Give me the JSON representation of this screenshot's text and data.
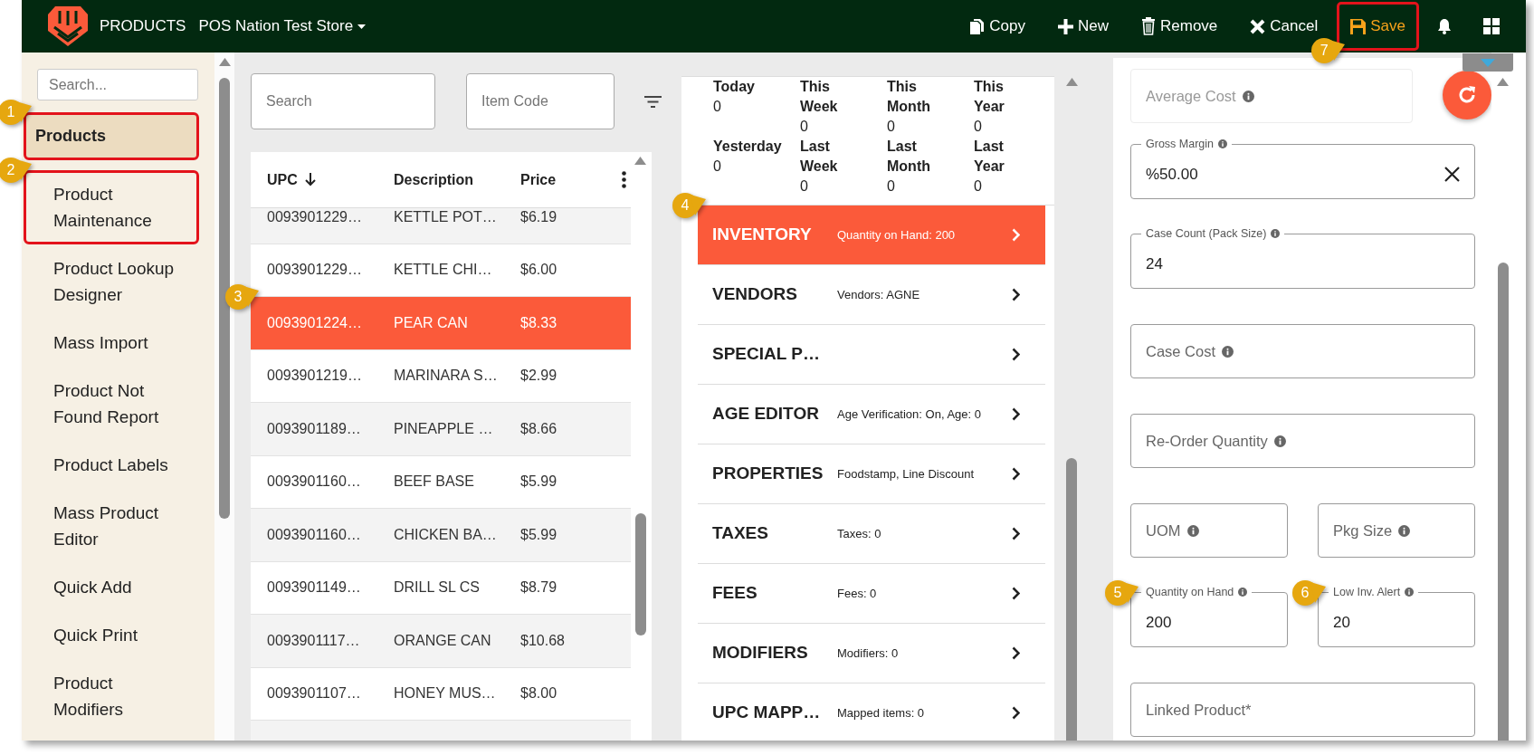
{
  "topbar": {
    "title": "PRODUCTS",
    "store": "POS Nation Test Store",
    "actions": [
      {
        "kind": "copy",
        "label": "Copy",
        "highlighted": false
      },
      {
        "kind": "new",
        "label": "New",
        "highlighted": false
      },
      {
        "kind": "remove",
        "label": "Remove",
        "highlighted": false
      },
      {
        "kind": "cancel",
        "label": "Cancel",
        "highlighted": false
      },
      {
        "kind": "save",
        "label": "Save",
        "highlighted": true,
        "callout": "7"
      },
      {
        "kind": "notifications",
        "highlighted": false
      },
      {
        "kind": "apps",
        "highlighted": false
      }
    ]
  },
  "sidebar": {
    "search": {
      "placeholder": "Search..."
    },
    "items": [
      {
        "kind": "category",
        "label": "Products",
        "highlighted": true,
        "callout": "1"
      },
      {
        "kind": "link",
        "label": "Product Maintenance",
        "highlighted": true,
        "callout": "2"
      },
      {
        "kind": "link",
        "label": "Product Lookup Designer",
        "highlighted": false
      },
      {
        "kind": "link",
        "label": "Mass Import",
        "highlighted": false
      },
      {
        "kind": "link",
        "label": "Product Not Found Report",
        "highlighted": false
      },
      {
        "kind": "link",
        "label": "Product Labels",
        "highlighted": false
      },
      {
        "kind": "link",
        "label": "Mass Product Editor",
        "highlighted": false
      },
      {
        "kind": "link",
        "label": "Quick Add",
        "highlighted": false
      },
      {
        "kind": "link",
        "label": "Quick Print",
        "highlighted": false
      },
      {
        "kind": "link",
        "label": "Product Modifiers",
        "highlighted": false
      }
    ]
  },
  "product_list": {
    "search": {
      "placeholder": "Search"
    },
    "item_code": {
      "placeholder": "Item Code"
    },
    "columns": [
      {
        "label": "UPC",
        "sorted": true
      },
      {
        "label": "Description",
        "sorted": false
      },
      {
        "label": "Price",
        "sorted": false
      }
    ],
    "rows": [
      {
        "upc": "0093901229…",
        "description": "KETTLE POT…",
        "price": "$6.19",
        "selected": false
      },
      {
        "upc": "0093901229…",
        "description": "KETTLE CHI…",
        "price": "$6.00",
        "selected": false
      },
      {
        "upc": "0093901224…",
        "description": "PEAR CAN",
        "price": "$8.33",
        "selected": true,
        "callout": "3"
      },
      {
        "upc": "0093901219…",
        "description": "MARINARA S…",
        "price": "$2.99",
        "selected": false
      },
      {
        "upc": "0093901189…",
        "description": "PINEAPPLE …",
        "price": "$8.66",
        "selected": false
      },
      {
        "upc": "0093901160…",
        "description": "BEEF BASE",
        "price": "$5.99",
        "selected": false
      },
      {
        "upc": "0093901160…",
        "description": "CHICKEN BA…",
        "price": "$5.99",
        "selected": false
      },
      {
        "upc": "0093901149…",
        "description": "DRILL SL CS",
        "price": "$8.79",
        "selected": false
      },
      {
        "upc": "0093901117…",
        "description": "ORANGE CAN",
        "price": "$10.68",
        "selected": false
      },
      {
        "upc": "0093901107…",
        "description": "HONEY MUS…",
        "price": "$8.00",
        "selected": false
      }
    ]
  },
  "details": {
    "stats": [
      {
        "label": "Today",
        "value": "0"
      },
      {
        "label": "This Week",
        "value": "0"
      },
      {
        "label": "This Month",
        "value": "0"
      },
      {
        "label": "This Year",
        "value": "0"
      },
      {
        "label": "Yesterday",
        "value": "0"
      },
      {
        "label": "Last Week",
        "value": "0"
      },
      {
        "label": "Last Month",
        "value": "0"
      },
      {
        "label": "Last Year",
        "value": "0"
      }
    ],
    "sections": [
      {
        "title": "INVENTORY",
        "summary": "Quantity on Hand: 200",
        "selected": true,
        "callout": "4"
      },
      {
        "title": "VENDORS",
        "summary": "Vendors: AGNE",
        "selected": false
      },
      {
        "title": "SPECIAL P…",
        "selected": false
      },
      {
        "title": "AGE EDITOR",
        "summary": "Age Verification: On, Age: 0",
        "selected": false
      },
      {
        "title": "PROPERTIES",
        "summary": "Foodstamp, Line Discount",
        "selected": false
      },
      {
        "title": "TAXES",
        "summary": "Taxes: 0",
        "selected": false
      },
      {
        "title": "FEES",
        "summary": "Fees: 0",
        "selected": false
      },
      {
        "title": "MODIFIERS",
        "summary": "Modifiers: 0",
        "selected": false
      },
      {
        "title": "UPC MAPP…",
        "summary": "Mapped items: 0",
        "selected": false
      }
    ]
  },
  "form": {
    "rows": [
      {
        "fields": [
          {
            "label": "Average Cost",
            "info": true,
            "disabled": true
          }
        ]
      },
      {
        "fields": [
          {
            "label": "Gross Margin",
            "value": "%50.00",
            "info": true,
            "disabled": false,
            "clearable": true
          }
        ]
      },
      {
        "fields": [
          {
            "label": "Case Count (Pack Size)",
            "value": "24",
            "info": true,
            "disabled": false
          }
        ]
      },
      {
        "fields": [
          {
            "label": "Case Cost",
            "info": true,
            "disabled": false
          }
        ]
      },
      {
        "fields": [
          {
            "label": "Re-Order Quantity",
            "info": true,
            "disabled": false
          }
        ]
      },
      {
        "fields": [
          {
            "label": "UOM",
            "info": true,
            "disabled": false
          },
          {
            "label": "Pkg Size",
            "info": true,
            "disabled": false
          }
        ]
      },
      {
        "fields": [
          {
            "label": "Quantity on Hand",
            "value": "200",
            "info": true,
            "disabled": false,
            "callout": "5"
          },
          {
            "label": "Low Inv. Alert",
            "value": "20",
            "info": true,
            "disabled": false,
            "callout": "6"
          }
        ]
      },
      {
        "fields": [
          {
            "label": "Linked Product*",
            "info": false,
            "disabled": false
          }
        ]
      }
    ]
  }
}
